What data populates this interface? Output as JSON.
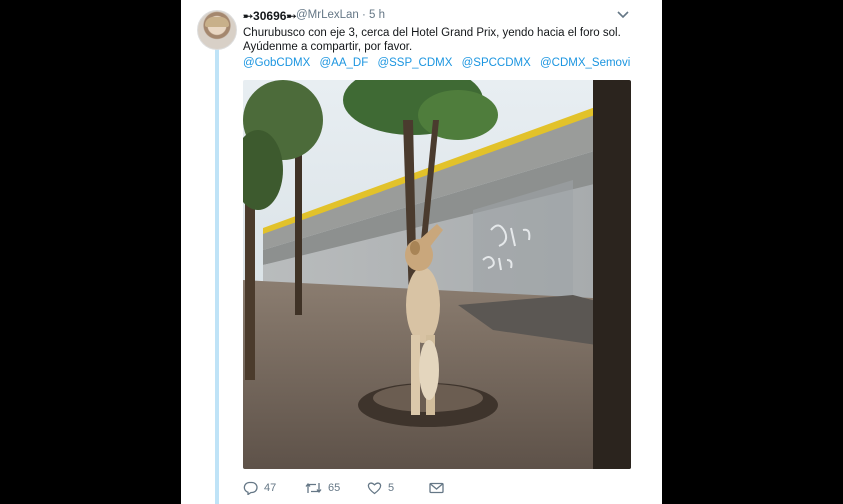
{
  "tweet": {
    "author_name": "➸30696➸",
    "author_handle": "@MrLexLan",
    "time": "· 5 h",
    "text_line1": "Churubusco con eje 3, cerca del Hotel Grand Prix, yendo hacia el foro sol.",
    "text_line2": "Ayúdenme a compartir, por favor.",
    "mentions": [
      "@GobCDMX",
      "@AA_DF",
      "@SSP_CDMX",
      "@SPCCDMX",
      "@CDMX_Semovi"
    ]
  },
  "actions": {
    "replies": "47",
    "retweets": "65",
    "likes": "5"
  },
  "icons": {
    "reply": "speech-bubble-icon",
    "retweet": "retweet-arrows-icon",
    "like": "heart-icon",
    "dm": "envelope-icon",
    "more": "chevron-down-icon"
  },
  "colors": {
    "link": "#1b95e0",
    "muted": "#657786",
    "thread": "#bfe3f7"
  }
}
